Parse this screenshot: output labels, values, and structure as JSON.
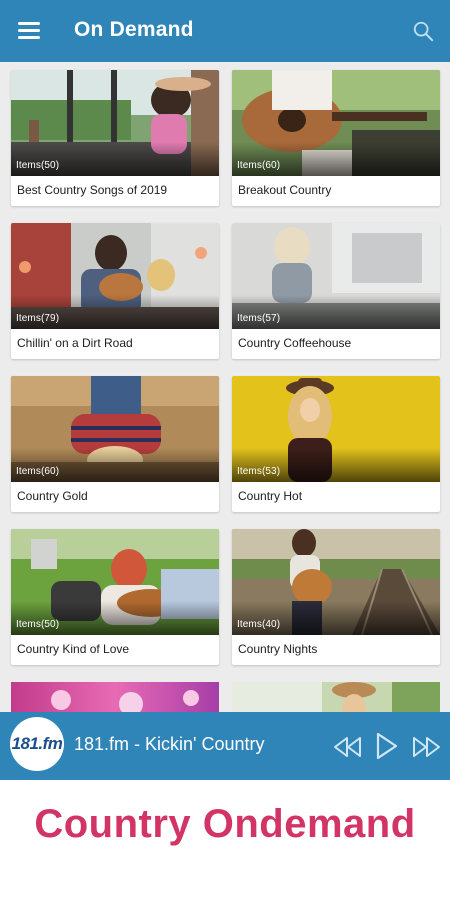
{
  "appbar": {
    "title": "On Demand",
    "menu_icon": "hamburger-menu-icon",
    "search_icon": "search-icon"
  },
  "cards": [
    {
      "items": "Items(50)",
      "title": "Best Country Songs of 2019"
    },
    {
      "items": "Items(60)",
      "title": "Breakout Country"
    },
    {
      "items": "Items(79)",
      "title": "Chillin' on a Dirt Road"
    },
    {
      "items": "Items(57)",
      "title": "Country Coffeehouse"
    },
    {
      "items": "Items(60)",
      "title": "Country Gold"
    },
    {
      "items": "Items(53)",
      "title": "Country Hot"
    },
    {
      "items": "Items(50)",
      "title": "Country Kind of Love"
    },
    {
      "items": "Items(40)",
      "title": "Country Nights"
    }
  ],
  "player": {
    "logo_text": "181.fm",
    "now_playing": "181.fm - Kickin' Country",
    "controls": [
      "rewind-icon",
      "play-icon",
      "fast-forward-icon"
    ]
  },
  "caption": "Country Ondemand",
  "colors": {
    "primary": "#2f84b8",
    "caption": "#d23565",
    "background": "#ececec"
  }
}
